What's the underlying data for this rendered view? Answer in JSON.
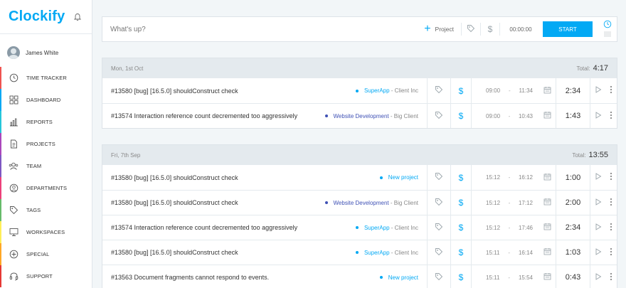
{
  "app": {
    "logo_text": "Clockify"
  },
  "user": {
    "name": "James White"
  },
  "sidebar": {
    "items": [
      {
        "label": "TIME TRACKER",
        "color": "#ef5350",
        "icon": "clock-icon"
      },
      {
        "label": "DASHBOARD",
        "color": "#03a9f4",
        "icon": "dashboard-icon"
      },
      {
        "label": "REPORTS",
        "color": "#26c6da",
        "icon": "reports-icon"
      },
      {
        "label": "PROJECTS",
        "color": "#ab47bc",
        "icon": "projects-icon"
      },
      {
        "label": "TEAM",
        "color": "#7e57c2",
        "icon": "team-icon"
      },
      {
        "label": "DEPARTMENTS",
        "color": "#ec407a",
        "icon": "departments-icon"
      },
      {
        "label": "TAGS",
        "color": "#66bb6a",
        "icon": "tag-icon"
      },
      {
        "label": "WORKSPACES",
        "color": "#ffee58",
        "icon": "workspaces-icon"
      },
      {
        "label": "SPECIAL",
        "color": "#ffa726",
        "icon": "special-icon"
      },
      {
        "label": "SUPPORT",
        "color": "#e53935",
        "icon": "support-icon"
      }
    ]
  },
  "timer": {
    "placeholder": "What's up?",
    "project_label": "Project",
    "time": "00:00:00",
    "start_label": "START"
  },
  "days": [
    {
      "date": "Mon, 1st Oct",
      "total_label": "Total:",
      "total": "4:17",
      "entries": [
        {
          "description": "#13580 [bug] [16.5.0] shouldConstruct check",
          "project": "SuperApp",
          "client": "- Client Inc",
          "dot": "#03a9f4",
          "project_color": "#03a9f4",
          "start": "09:00",
          "end": "11:34",
          "duration": "2:34"
        },
        {
          "description": "#13574 Interaction reference count decremented too aggressively",
          "project": "Website Development",
          "client": "- Big Client",
          "dot": "#3f51b5",
          "project_color": "#3f51b5",
          "start": "09:00",
          "end": "10:43",
          "duration": "1:43"
        }
      ]
    },
    {
      "date": "Fri, 7th Sep",
      "total_label": "Total:",
      "total": "13:55",
      "entries": [
        {
          "description": "#13580 [bug] [16.5.0] shouldConstruct check",
          "project": "New project",
          "client": "",
          "dot": "#03a9f4",
          "project_color": "#03a9f4",
          "start": "15:12",
          "end": "16:12",
          "duration": "1:00"
        },
        {
          "description": "#13580 [bug] [16.5.0] shouldConstruct check",
          "project": "Website Development",
          "client": "- Big Client",
          "dot": "#3f51b5",
          "project_color": "#3f51b5",
          "start": "15:12",
          "end": "17:12",
          "duration": "2:00"
        },
        {
          "description": "#13574 Interaction reference count decremented too aggressively",
          "project": "SuperApp",
          "client": "- Client Inc",
          "dot": "#03a9f4",
          "project_color": "#03a9f4",
          "start": "15:12",
          "end": "17:46",
          "duration": "2:34"
        },
        {
          "description": "#13580 [bug] [16.5.0] shouldConstruct check",
          "project": "SuperApp",
          "client": "- Client Inc",
          "dot": "#03a9f4",
          "project_color": "#03a9f4",
          "start": "15:11",
          "end": "16:14",
          "duration": "1:03"
        },
        {
          "description": "#13563 Document fragments cannot respond to events.",
          "project": "New project",
          "client": "",
          "dot": "#03a9f4",
          "project_color": "#03a9f4",
          "start": "15:11",
          "end": "15:54",
          "duration": "0:43"
        }
      ]
    }
  ]
}
